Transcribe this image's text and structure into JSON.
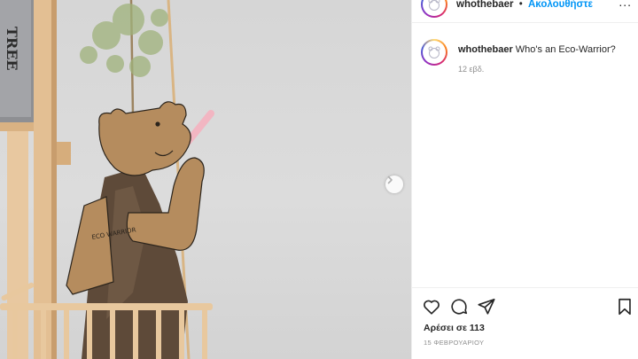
{
  "header": {
    "username": "whothebaer",
    "separator": "•",
    "follow_label": "Ακολουθήστε",
    "more_label": "..."
  },
  "post": {
    "caption_user": "whothebaer",
    "caption_text": "Who's an Eco-Warrior?",
    "time_ago": "12 εβδ.",
    "likes_label": "Αρέσει σε 113",
    "date_label": "15 ΦΕΒΡΟΥΑΡΙΟΥ"
  },
  "photo": {
    "sign_text": "TREE",
    "tag_text": "ECO WARRIOR"
  },
  "colors": {
    "accent": "#0095f6",
    "text": "#262626",
    "muted": "#8e8e8e",
    "border": "#efefef"
  },
  "icons": {
    "like": "heart-icon",
    "comment": "comment-icon",
    "share": "paper-plane-icon",
    "save": "bookmark-icon",
    "next": "chevron-right-icon"
  }
}
